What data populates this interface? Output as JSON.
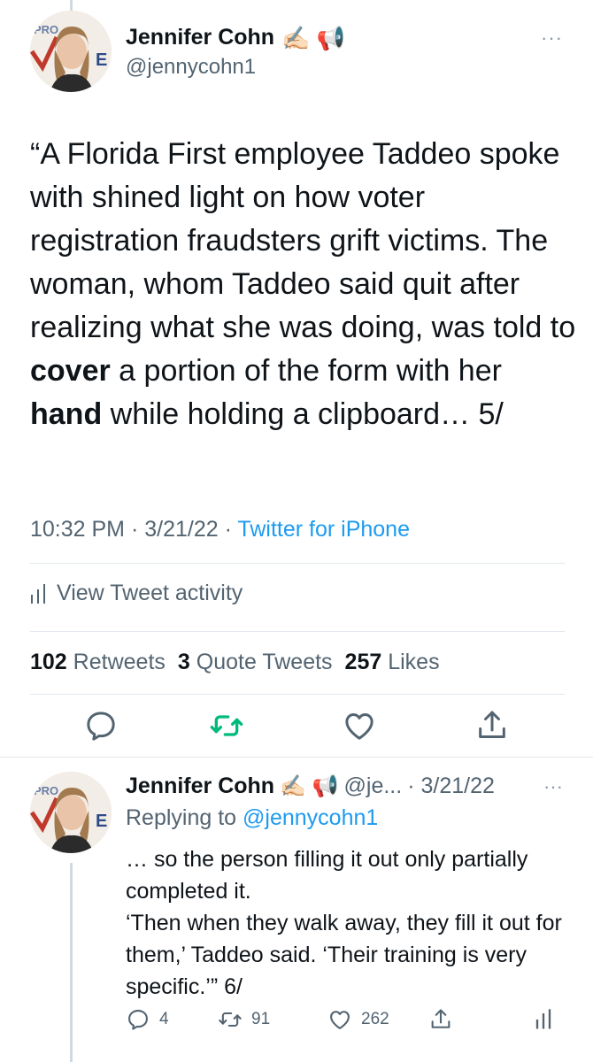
{
  "main_tweet": {
    "author_name": "Jennifer Cohn",
    "author_emojis": "✍🏻 📢",
    "handle": "@jennycohn1",
    "more_icon": "···",
    "text_parts": [
      "“A Florida First employee Taddeo spoke with shined light on how voter registration fraudsters grift victims. The woman, whom Taddeo said quit after realizing what she was doing, was told to ",
      "cover",
      " a portion of the form with her ",
      "hand",
      " while holding a clipboard… 5/"
    ],
    "time": "10:32 PM",
    "date": "3/21/22",
    "separator": "·",
    "source": "Twitter for iPhone",
    "activity_label": "View Tweet activity",
    "stats": {
      "retweets_count": "102",
      "retweets_label": "Retweets",
      "quotes_count": "3",
      "quotes_label": "Quote Tweets",
      "likes_count": "257",
      "likes_label": "Likes"
    }
  },
  "reply_tweet": {
    "author_name": "Jennifer Cohn",
    "author_emojis": "✍🏻 📢",
    "handle_truncated": "@je...",
    "date": "· 3/21/22",
    "more_icon": "···",
    "replying_prefix": "Replying to",
    "replying_to": "@jennycohn1",
    "text": "… so the person filling it out only partially completed it.\n‘Then when they walk away, they fill it out for them,’ Taddeo said. ‘Their training is very specific.’” 6/",
    "reply_count": "4",
    "retweet_count": "91",
    "like_count": "262"
  },
  "colors": {
    "accent": "#1d9bf0",
    "retweet_green": "#00ba7c",
    "secondary_text": "#536471",
    "divider": "#e1e8ed"
  },
  "icons": [
    "reply-icon",
    "retweet-icon",
    "like-icon",
    "share-icon",
    "analytics-icon",
    "more-icon"
  ]
}
